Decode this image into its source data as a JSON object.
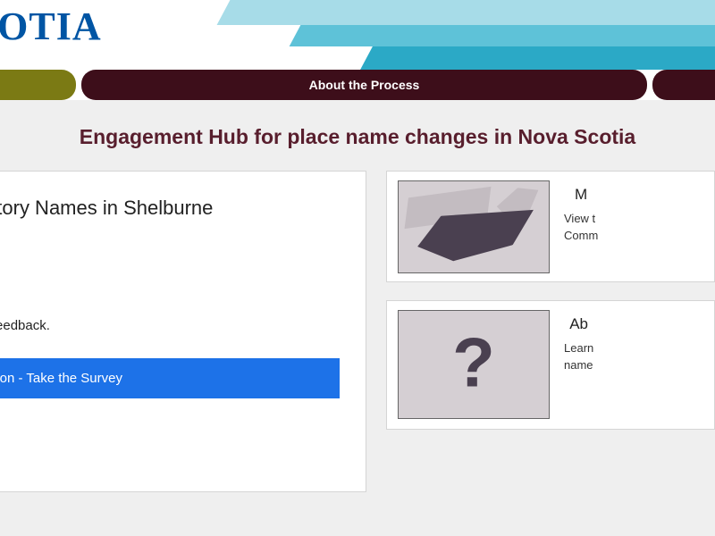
{
  "header": {
    "logo_text_partial": "COTIA"
  },
  "nav": {
    "about_process": "About the Process"
  },
  "page": {
    "title": "Engagement Hub for place name changes in Nova Scotia"
  },
  "main_card": {
    "heading": "erogatory Names in Shelburne",
    "description": "re your feedback.",
    "cta": "ormation - Take the Survey"
  },
  "side_map": {
    "title": "M",
    "line1": "View t",
    "line2": "Comm"
  },
  "side_about": {
    "title": "Ab",
    "line1": "Learn",
    "line2": "name"
  }
}
